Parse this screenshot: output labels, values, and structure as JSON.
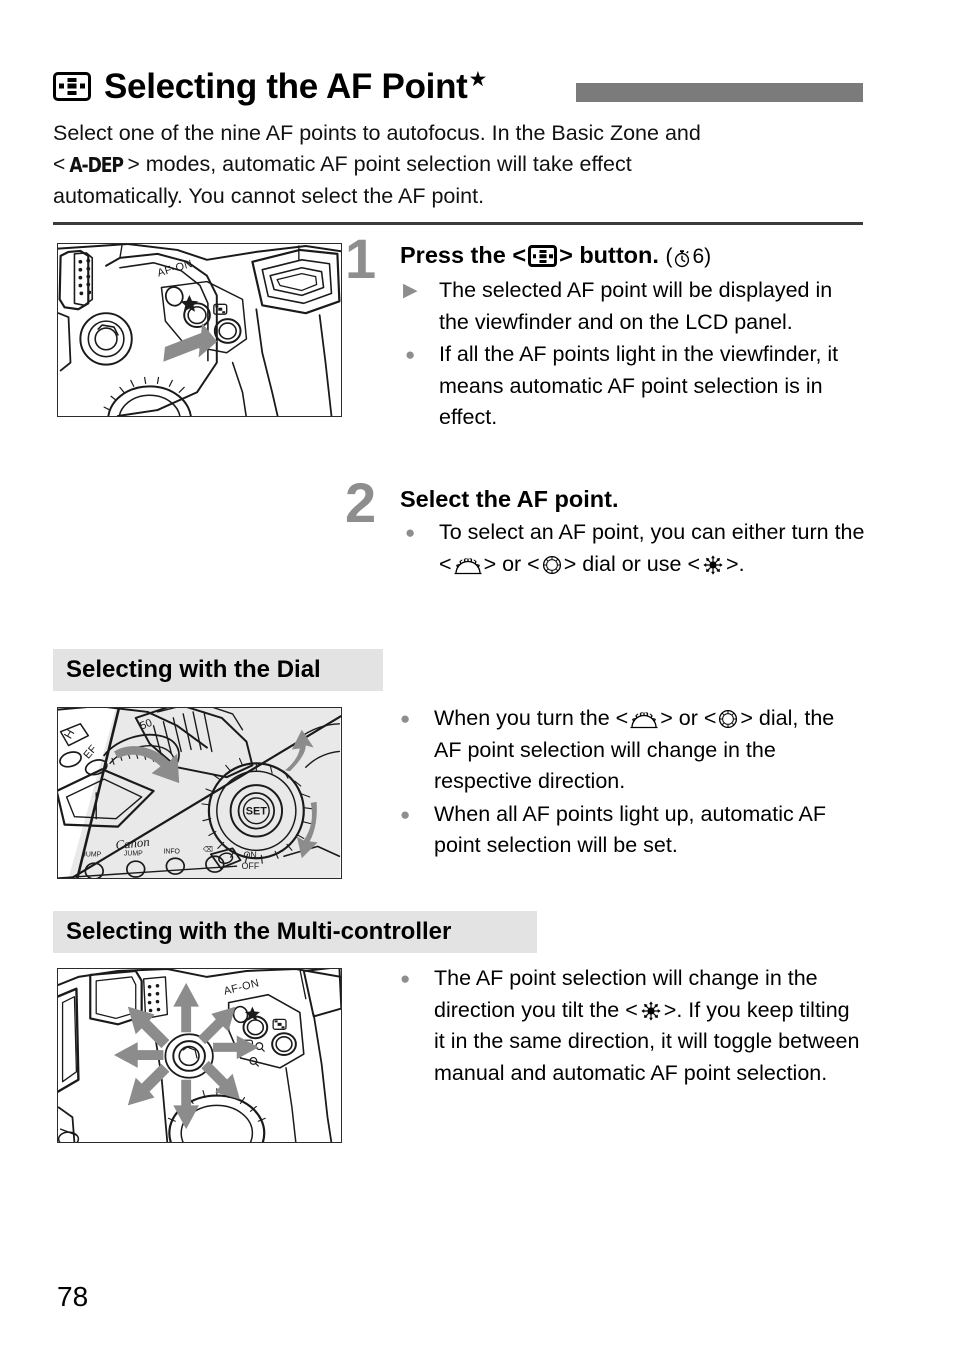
{
  "page": {
    "number": "78",
    "title": "Selecting the AF Point",
    "title_star": "★",
    "title_icon": "af-point-selection-icon",
    "accent_bar_color": "#7b7b7b",
    "step_number_color": "#8e8e8e",
    "banner_bg_color": "#e3e3e3"
  },
  "intro": {
    "line1": "Select one of the nine AF points to autofocus. In the Basic Zone and",
    "angle_open": "<",
    "mode_label": "A-DEP",
    "angle_close": ">",
    "line2_tail": " modes, automatic AF point selection will take effect",
    "line3": "automatically. You cannot select the AF point."
  },
  "steps": [
    {
      "number": "1",
      "heading_before": "Press the <",
      "heading_icon": "af-point-selection-icon",
      "heading_after": "> button.",
      "note_open": "(",
      "note_icon": "stopwatch-icon",
      "note_value": "6",
      "note_close": ")",
      "bullets": [
        {
          "marker": "triangle",
          "text": "The selected AF point will be displayed in the viewfinder and on the LCD panel."
        },
        {
          "marker": "dot",
          "text": "If all the AF points light in the viewfinder, it means automatic AF point selection is in effect."
        }
      ],
      "illustration": "camera-rear-af-point-button"
    },
    {
      "number": "2",
      "heading": "Select the AF point.",
      "bullets": [
        {
          "marker": "dot",
          "parts": [
            "To select an AF point, you can either turn the <",
            "main-dial-icon",
            "> or <",
            "quick-control-dial-icon",
            "> dial or use <",
            "multi-controller-icon",
            ">."
          ]
        }
      ]
    }
  ],
  "sections": [
    {
      "banner": "Selecting with the Dial",
      "illustration": "camera-main-dial-and-quick-control-dial",
      "bullets": [
        {
          "marker": "dot",
          "parts": [
            "When you turn the <",
            "main-dial-icon",
            "> or <",
            "quick-control-dial-icon",
            "> dial, the AF point selection will change in the respective direction."
          ]
        },
        {
          "marker": "dot",
          "text": "When all AF points light up, automatic AF point selection will be set."
        }
      ]
    },
    {
      "banner": "Selecting with the Multi-controller",
      "illustration": "camera-multi-controller-directions",
      "bullets": [
        {
          "marker": "dot",
          "parts": [
            "The AF point selection will change in the direction you tilt the <",
            "multi-controller-icon",
            ">. If you keep tilting it in the same direction, it will toggle between manual and automatic AF point selection."
          ]
        }
      ]
    }
  ],
  "illustration_labels": {
    "af_on": "AF-ON",
    "set": "SET",
    "on": "ON",
    "off": "OFF",
    "canon": "Canon",
    "jump": "JUMP",
    "info": "INFO",
    "focal": "50",
    "ef": "EF"
  }
}
